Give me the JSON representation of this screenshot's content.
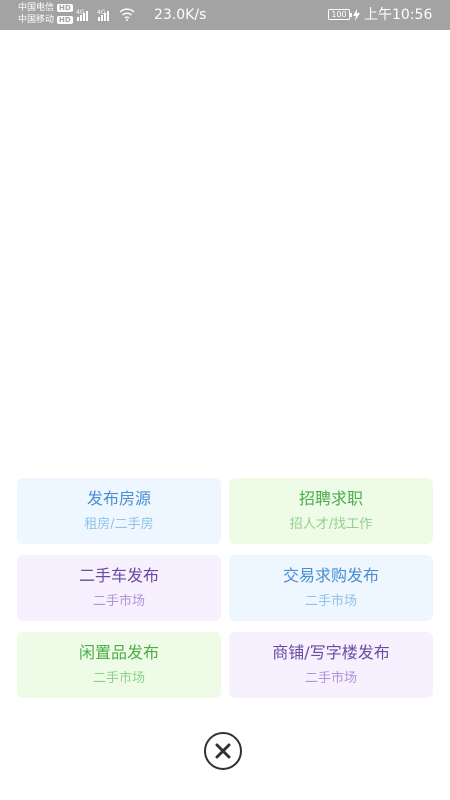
{
  "status_bar": {
    "carrier1": "中国电信",
    "carrier2": "中国移动",
    "hd_badge": "HD",
    "network_label": "4G",
    "net_speed": "23.0K/s",
    "battery": "100",
    "time": "上午10:56"
  },
  "menu": [
    {
      "title": "发布房源",
      "subtitle": "租房/二手房",
      "bg": "#eef6ff",
      "title_color": "#4a8fd0",
      "sub_color": "#8fc3e8"
    },
    {
      "title": "招聘求职",
      "subtitle": "招人才/找工作",
      "bg": "#eefbe7",
      "title_color": "#4aad4a",
      "sub_color": "#8fd08a"
    },
    {
      "title": "二手车发布",
      "subtitle": "二手市场",
      "bg": "#f6f0ff",
      "title_color": "#6a4aa0",
      "sub_color": "#ae96d8"
    },
    {
      "title": "交易求购发布",
      "subtitle": "二手市场",
      "bg": "#eef6ff",
      "title_color": "#4a8fd0",
      "sub_color": "#8fc3e8"
    },
    {
      "title": "闲置品发布",
      "subtitle": "二手市场",
      "bg": "#eefbe7",
      "title_color": "#4aad4a",
      "sub_color": "#8fd08a"
    },
    {
      "title": "商铺/写字楼发布",
      "subtitle": "二手市场",
      "bg": "#f6f0ff",
      "title_color": "#6a4aa0",
      "sub_color": "#ae96d8"
    }
  ],
  "close_icon": "close-circle-icon"
}
